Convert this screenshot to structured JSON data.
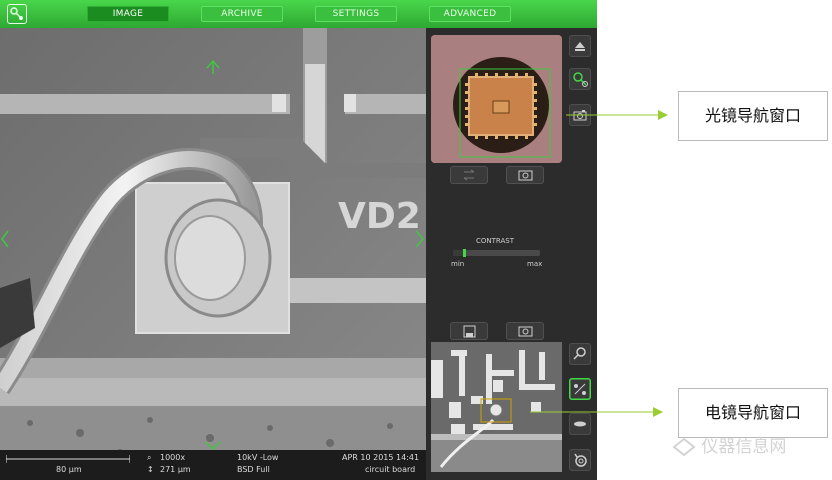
{
  "tabs": [
    {
      "label": "IMAGE",
      "active": true
    },
    {
      "label": "ARCHIVE",
      "active": false
    },
    {
      "label": "SETTINGS",
      "active": false
    },
    {
      "label": "ADVANCED",
      "active": false
    }
  ],
  "sem_image": {
    "engraved_text": "VD2"
  },
  "status": {
    "scale_bar": "80 µm",
    "magnification": "1000x",
    "field_width": "271 µm",
    "voltage": "10kV -Low",
    "detector": "BSD Full",
    "timestamp": "APR 10 2015 14:41",
    "sample": "circuit board"
  },
  "contrast": {
    "label": "CONTRAST",
    "min_label": "min",
    "max_label": "max",
    "level": 0.12
  },
  "callouts": {
    "optical": "光镜导航窗口",
    "sem": "电镜导航窗口"
  },
  "watermark": "仪器信息网",
  "colors": {
    "accent_green": "#3ec83f",
    "callout_line": "#9acd32",
    "panel_bg": "#2c2c2c"
  },
  "icons": {
    "logo": "microscope-logo-icon",
    "eject": "eject-icon",
    "zoom_nav": "navigation-zoom-icon",
    "camera": "camera-icon",
    "zoom": "zoom-icon",
    "compass": "measure-icon",
    "cycle": "rotate-icon"
  }
}
